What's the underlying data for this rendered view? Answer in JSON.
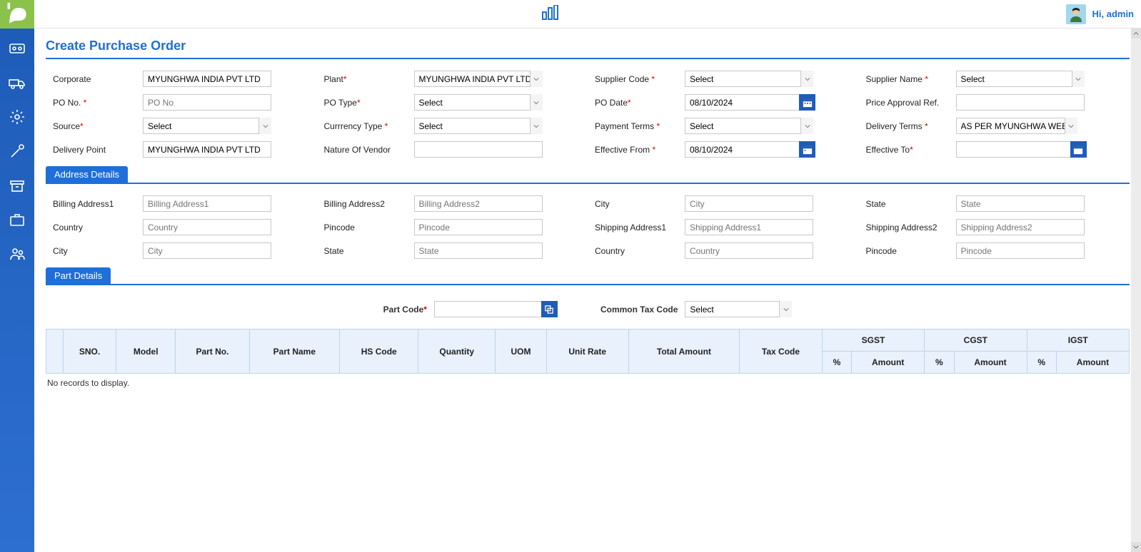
{
  "header": {
    "greeting": "Hi, admin"
  },
  "page": {
    "title": "Create Purchase Order"
  },
  "form": {
    "corporate_label": "Corporate",
    "corporate_value": "MYUNGHWA INDIA PVT LTD",
    "plant_label": "Plant",
    "plant_value": "MYUNGHWA INDIA PVT LTD",
    "suppliercode_label": "Supplier Code",
    "suppliercode_value": "Select",
    "suppliername_label": "Supplier Name",
    "suppliername_value": "Select",
    "pono_label": "PO No.",
    "pono_placeholder": "PO No",
    "potype_label": "PO Type",
    "potype_value": "Select",
    "podate_label": "PO Date",
    "podate_value": "08/10/2024",
    "priceref_label": "Price Approval Ref.",
    "priceref_value": "",
    "source_label": "Source",
    "source_value": "Select",
    "currency_label": "Currrency Type",
    "currency_value": "Select",
    "payment_label": "Payment Terms",
    "payment_value": "Select",
    "delivery_label": "Delivery Terms",
    "delivery_value": "AS PER MYUNGHWA WEEKLY SCHE",
    "delpoint_label": "Delivery Point",
    "delpoint_value": "MYUNGHWA INDIA PVT LTD",
    "nov_label": "Nature Of Vendor",
    "nov_value": "",
    "efffrom_label": "Effective From",
    "efffrom_value": "08/10/2024",
    "effto_label": "Effective To",
    "effto_value": ""
  },
  "sections": {
    "address": "Address Details",
    "parts": "Part Details"
  },
  "address": {
    "ba1_label": "Billing Address1",
    "ba1_ph": "Billing Address1",
    "ba2_label": "Billing Address2",
    "ba2_ph": "Billing Address2",
    "bcity_label": "City",
    "bcity_ph": "City",
    "bstate_label": "State",
    "bstate_ph": "State",
    "bcountry_label": "Country",
    "bcountry_ph": "Country",
    "bpin_label": "Pincode",
    "bpin_ph": "Pincode",
    "sa1_label": "Shipping Address1",
    "sa1_ph": "Shipping Address1",
    "sa2_label": "Shipping Address2",
    "sa2_ph": "Shipping Address2",
    "scity_label": "City",
    "scity_ph": "City",
    "sstate_label": "State",
    "sstate_ph": "State",
    "scountry_label": "Country",
    "scountry_ph": "Country",
    "spin_label": "Pincode",
    "spin_ph": "Pincode"
  },
  "parts": {
    "partcode_label": "Part Code",
    "taxcode_label": "Common Tax Code",
    "taxcode_value": "Select",
    "columns": {
      "sno": "SNO.",
      "model": "Model",
      "partno": "Part No.",
      "partname": "Part Name",
      "hscode": "HS Code",
      "qty": "Quantity",
      "uom": "UOM",
      "unitrate": "Unit Rate",
      "total": "Total Amount",
      "taxcode": "Tax Code",
      "sgst": "SGST",
      "cgst": "CGST",
      "igst": "IGST",
      "pct": "%",
      "amt": "Amount"
    },
    "empty": "No records to display."
  }
}
